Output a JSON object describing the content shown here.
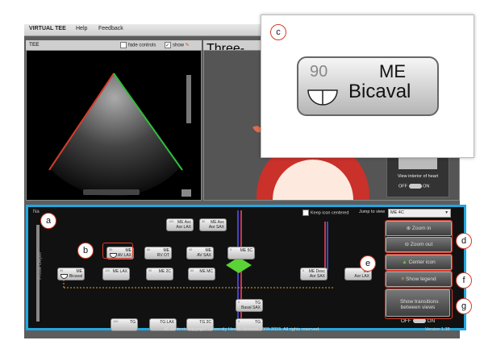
{
  "menubar": {
    "app_title": "VIRTUAL TEE",
    "help": "Help",
    "feedback": "Feedback"
  },
  "tee_panel": {
    "title": "TEE",
    "fade_controls": "fade controls",
    "show": "show"
  },
  "threed_panel": {
    "title": "Three-dimensional vi",
    "view_interior": "View interior of heart",
    "off": "OFF",
    "on": "ON"
  },
  "nav": {
    "label": "Na",
    "keep_icon_centered": "Keep icon centered",
    "jump_to_view": "Jump to view",
    "jump_value": "ME 4C",
    "probe_depth": "Probe Depth",
    "nodes": [
      {
        "num": "120",
        "name": "ME Asc\nAor LAX"
      },
      {
        "num": "30",
        "name": "ME Asc\nAor SAX"
      },
      {
        "num": "30",
        "name": "ME\nAV LAX"
      },
      {
        "num": "60",
        "name": "ME\nRV OT"
      },
      {
        "num": "40",
        "name": "ME\nAV SAX"
      },
      {
        "num": "0",
        "name": "ME 5C"
      },
      {
        "num": "90",
        "name": "ME\nBicaval"
      },
      {
        "num": "120",
        "name": "ME LAX"
      },
      {
        "num": "90",
        "name": "ME 2C"
      },
      {
        "num": "60",
        "name": "ME MC"
      },
      {
        "num": "0",
        "name": "ME Desc\nAor SAX"
      },
      {
        "num": "",
        "name": "ME\nAor LAX"
      },
      {
        "num": "0",
        "name": "TG\nBasal SAX"
      },
      {
        "num": "120",
        "name": "TG"
      },
      {
        "num": "",
        "name": "TG LAX"
      },
      {
        "num": "",
        "name": "TG 2C"
      },
      {
        "num": "0",
        "name": "TG"
      }
    ]
  },
  "side_buttons": {
    "zoom_in": "Zoom in",
    "zoom_out": "Zoom out",
    "center_icon": "Center icon",
    "show_legend": "Show legend",
    "show_transitions": "Show transitions\nbetween views",
    "off": "OFF",
    "on": "ON"
  },
  "footer": {
    "copyright": "All contents copyright University Health Network 2009-2015. All rights reserved.",
    "version": "Version 1.38"
  },
  "zoom_card": {
    "callout": "c",
    "num": "90",
    "line1": "ME",
    "line2": "Bicaval"
  },
  "callouts": {
    "a": "a",
    "b": "b",
    "d": "d",
    "e": "e",
    "f": "f",
    "g": "g"
  },
  "colors": {
    "accent_blue": "#23a7e0",
    "callout_red": "#d63c2a",
    "highlight_green": "#5bd236"
  }
}
